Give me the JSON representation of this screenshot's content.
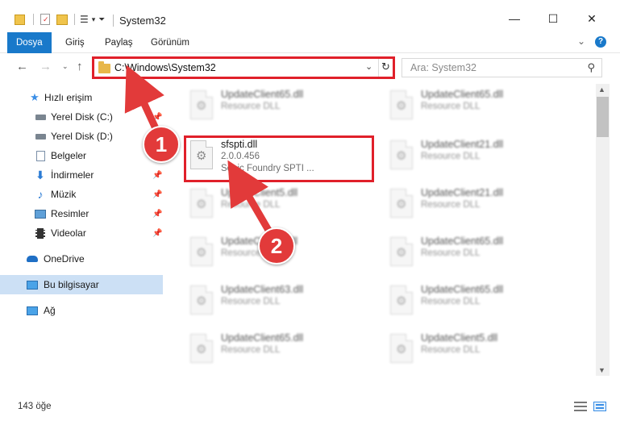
{
  "window": {
    "title": "System32",
    "minimize": "—",
    "maximize": "☐",
    "close": "✕"
  },
  "ribbon": {
    "tabs": [
      "Dosya",
      "Giriş",
      "Paylaş",
      "Görünüm"
    ],
    "expand": "⌄",
    "help": "?"
  },
  "address": {
    "path": "C:\\Windows\\System32",
    "dropdown": "⌄",
    "refresh": "↻"
  },
  "search": {
    "placeholder": "Ara: System32",
    "icon": "⚲"
  },
  "sidebar": {
    "items": [
      {
        "label": "Hızlı erişim",
        "icon": "star-icon"
      },
      {
        "label": "Yerel Disk (C:)",
        "icon": "drive-icon"
      },
      {
        "label": "Yerel Disk (D:)",
        "icon": "drive-icon"
      },
      {
        "label": "Belgeler",
        "icon": "documents-icon"
      },
      {
        "label": "İndirmeler",
        "icon": "download-icon"
      },
      {
        "label": "Müzik",
        "icon": "music-icon"
      },
      {
        "label": "Resimler",
        "icon": "pictures-icon"
      },
      {
        "label": "Videolar",
        "icon": "video-icon"
      },
      {
        "label": "OneDrive",
        "icon": "cloud-icon"
      },
      {
        "label": "Bu bilgisayar",
        "icon": "computer-icon"
      },
      {
        "label": "Ağ",
        "icon": "network-icon"
      }
    ]
  },
  "files": {
    "highlighted": {
      "name": "sfspti.dll",
      "version": "2.0.0.456",
      "description": "Sonic Foundry SPTI ..."
    },
    "tiles": [
      {
        "name": "UpdateClient65.dll",
        "type": "Resource DLL"
      },
      {
        "name": "UpdateClient65.dll",
        "type": "Resource DLL"
      },
      {
        "name": "UpdateClient21.dll",
        "type": "Resource DLL"
      },
      {
        "name": "UpdateClient5.dll",
        "type": "Resource DLL"
      },
      {
        "name": "UpdateClient21.dll",
        "type": "Resource DLL"
      },
      {
        "name": "UpdateClient9.dll",
        "type": "Resource DLL"
      },
      {
        "name": "UpdateClient65.dll",
        "type": "Resource DLL"
      },
      {
        "name": "UpdateClient63.dll",
        "type": "Resource DLL"
      },
      {
        "name": "UpdateClient65.dll",
        "type": "Resource DLL"
      },
      {
        "name": "UpdateClient65.dll",
        "type": "Resource DLL"
      },
      {
        "name": "UpdateClient5.dll",
        "type": "Resource DLL"
      }
    ]
  },
  "status": {
    "count": "143 öğe"
  },
  "callouts": {
    "one": "1",
    "two": "2"
  },
  "colors": {
    "highlight": "#e0202a",
    "accent": "#1979ca",
    "selected": "#cce0f5",
    "badge": "#e23a3a"
  }
}
